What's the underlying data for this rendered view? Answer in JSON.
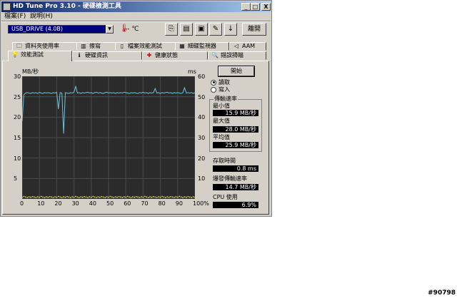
{
  "window": {
    "title": "HD Tune Pro 3.10 - 硬碟檢測工具",
    "minimize": "_",
    "maximize": "□",
    "close": "X"
  },
  "menu": {
    "file": "檔案(F)",
    "help": "說明(H)"
  },
  "toolbar": {
    "drive": "USB_DRIVE (4.0B)",
    "temperature": "-- ℃",
    "exit_label": "離開"
  },
  "tabs_row1": [
    {
      "label": "資料夾使用率",
      "icon": "folder-icon"
    },
    {
      "label": "擦寫",
      "icon": "trash-icon"
    },
    {
      "label": "檔案效能測試",
      "icon": "file-icon"
    },
    {
      "label": "細碟監視器",
      "icon": "monitor-icon"
    },
    {
      "label": "AAM",
      "icon": "speaker-icon"
    }
  ],
  "tabs_row2": [
    {
      "label": "效能測試",
      "icon": "bulb-icon"
    },
    {
      "label": "硬碟資訊",
      "icon": "info-icon"
    },
    {
      "label": "健康狀態",
      "icon": "health-cross-icon"
    },
    {
      "label": "錯誤掃瞄",
      "icon": "magnifier-icon"
    }
  ],
  "chart_labels": {
    "left_unit": "MB/秒",
    "right_unit": "ms",
    "left_ticks": [
      "30",
      "25",
      "20",
      "15",
      "10",
      "5"
    ],
    "right_ticks": [
      "60",
      "50",
      "40",
      "30",
      "20",
      "10"
    ],
    "x_ticks": [
      "0",
      "10",
      "20",
      "30",
      "40",
      "50",
      "60",
      "70",
      "80",
      "90",
      "100%"
    ]
  },
  "controls": {
    "start_button": "開始",
    "read_label": "讀取",
    "write_label": "寫入",
    "read_selected": true
  },
  "stats": {
    "transfer_rate_title": "傳輸速率",
    "min_label": "最小值",
    "min_value": "15.9 MB/秒",
    "max_label": "最大值",
    "max_value": "28.0 MB/秒",
    "avg_label": "平均值",
    "avg_value": "25.9 MB/秒",
    "access_label": "存取時間",
    "access_value": "0.8 ms",
    "burst_label": "爆發傳輸速率",
    "burst_value": "14.7 MB/秒",
    "cpu_label": "CPU 使用",
    "cpu_value": "6.9%"
  },
  "watermark": "#90798",
  "chart_data": {
    "type": "line",
    "x": [
      0,
      1,
      2,
      3,
      4,
      5,
      6,
      7,
      8,
      9,
      10,
      11,
      12,
      13,
      14,
      15,
      16,
      17,
      18,
      19,
      20,
      21,
      22,
      23,
      24,
      25,
      26,
      27,
      28,
      29,
      30,
      31,
      32,
      33,
      34,
      35,
      36,
      37,
      38,
      39,
      40,
      41,
      42,
      43,
      44,
      45,
      46,
      47,
      48,
      49,
      50,
      51,
      52,
      53,
      54,
      55,
      56,
      57,
      58,
      59,
      60,
      61,
      62,
      63,
      64,
      65,
      66,
      67,
      68,
      69,
      70,
      71,
      72,
      73,
      74,
      75,
      76,
      77,
      78,
      79,
      80,
      81,
      82,
      83,
      84,
      85,
      86,
      87,
      88,
      89,
      90,
      91,
      92,
      93,
      94,
      95,
      96,
      97,
      98,
      99,
      100
    ],
    "series": [
      {
        "values": [
          19,
          25.5,
          25.9,
          26.0,
          25.9,
          25.8,
          26.0,
          25.9,
          26.0,
          25.8,
          26.1,
          25.9,
          25.8,
          26.0,
          25.9,
          26.0,
          25.9,
          25.8,
          26.0,
          25.9,
          26.1,
          22,
          26.0,
          25.9,
          16,
          26.0,
          25.9,
          25.8,
          26.0,
          25.9,
          26.1,
          27.5,
          25.9,
          26.0,
          25.8,
          26.0,
          25.9,
          26.0,
          26.1,
          25.9,
          26.0,
          25.8,
          26.0,
          26.1,
          25.9,
          26.0,
          25.9,
          25.8,
          26.0,
          26.1,
          25.9,
          26.0,
          25.9,
          26.0,
          25.8,
          26.0,
          25.9,
          26.0,
          25.9,
          26.1,
          26.0,
          25.9,
          25.8,
          26.0,
          25.9,
          26.0,
          25.9,
          25.8,
          26.0,
          25.9,
          26.1,
          25.9,
          26.0,
          25.8,
          26.0,
          25.9,
          26.0,
          27.0,
          25.9,
          26.0,
          25.8,
          26.0,
          25.9,
          26.0,
          26.1,
          25.9,
          26.0,
          25.8,
          26.0,
          25.9,
          26.0,
          25.9,
          25.8,
          26.0,
          27.2,
          25.9,
          26.0,
          25.9,
          26.0,
          25.8,
          26.0
        ]
      },
      {
        "values": [
          0.8,
          1.2,
          0.9,
          0.7,
          1.0,
          0.8,
          1.1,
          0.9,
          0.7,
          1.0,
          0.8,
          1.2,
          0.9,
          0.7,
          1.0,
          0.8,
          1.1,
          0.9,
          0.7,
          1.0,
          0.8,
          1.2,
          0.9,
          0.7,
          1.0,
          0.8,
          1.1,
          0.9,
          0.7,
          1.0,
          0.8,
          1.2,
          0.9,
          0.7,
          1.0,
          0.8,
          1.1,
          0.9,
          0.7,
          1.0,
          0.8,
          1.2,
          0.9,
          0.7,
          1.0,
          0.8,
          1.1,
          0.9,
          0.7,
          1.0,
          0.8,
          1.2,
          0.9,
          0.7,
          1.0,
          0.8,
          1.1,
          0.9,
          0.7,
          1.0,
          0.8,
          1.2,
          0.9,
          0.7,
          1.0,
          0.8,
          1.1,
          0.9,
          0.7,
          1.0,
          0.8,
          1.2,
          0.9,
          0.7,
          1.0,
          0.8,
          1.1,
          0.9,
          0.7,
          1.0,
          0.8,
          1.2,
          0.9,
          0.7,
          1.0,
          0.8,
          1.1,
          0.9,
          0.7,
          1.0,
          0.8,
          1.2,
          0.9,
          0.7,
          1.0,
          0.8,
          1.1,
          0.9,
          0.7,
          1.0,
          0.8
        ]
      }
    ],
    "ylim": [
      0,
      30
    ],
    "y2lim": [
      0,
      60
    ],
    "xlim": [
      0,
      100
    ],
    "grid": true,
    "colors": [
      "#6fc3e0",
      "#e8e85a"
    ]
  }
}
